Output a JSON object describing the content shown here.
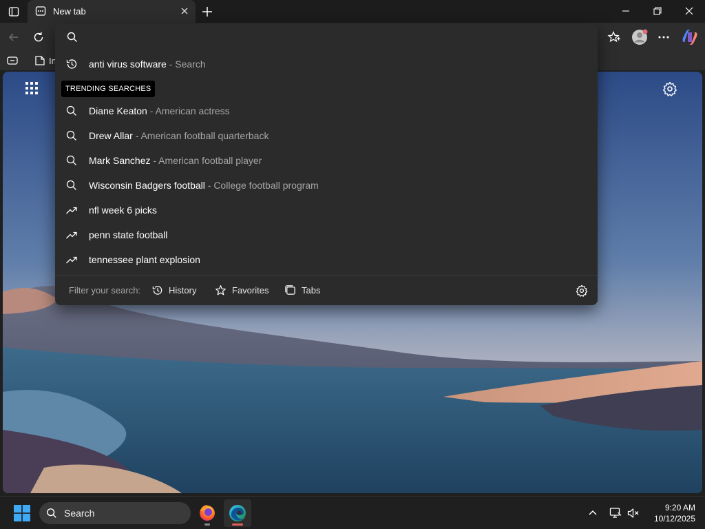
{
  "browser": {
    "tab_title": "New tab",
    "favorites_bar_label": "In"
  },
  "omnibox": {
    "placeholder": "",
    "history_item": {
      "main": "anti virus software",
      "sub": "- Search",
      "icon": "history-icon"
    },
    "trending_label": "TRENDING SEARCHES",
    "suggestions": [
      {
        "main": "Diane Keaton",
        "sub": "- American actress",
        "icon": "search-icon"
      },
      {
        "main": "Drew Allar",
        "sub": "- American football quarterback",
        "icon": "search-icon"
      },
      {
        "main": "Mark Sanchez",
        "sub": "- American football player",
        "icon": "search-icon"
      },
      {
        "main": "Wisconsin Badgers football",
        "sub": "- College football program",
        "icon": "search-icon"
      },
      {
        "main": "nfl week 6 picks",
        "sub": "",
        "icon": "trending-icon"
      },
      {
        "main": "penn state football",
        "sub": "",
        "icon": "trending-icon"
      },
      {
        "main": "tennessee plant explosion",
        "sub": "",
        "icon": "trending-icon"
      }
    ],
    "filter": {
      "label": "Filter your search:",
      "history": "History",
      "favorites": "Favorites",
      "tabs": "Tabs"
    }
  },
  "taskbar": {
    "search_label": "Search",
    "time": "9:20 AM",
    "date": "10/12/2025"
  },
  "colors": {
    "dropdown_bg": "#2b2b2b",
    "secondary_text": "#a6a6a6",
    "edge_indicator": "#e0605a",
    "firefox_indicator": "#8a8a8a"
  }
}
